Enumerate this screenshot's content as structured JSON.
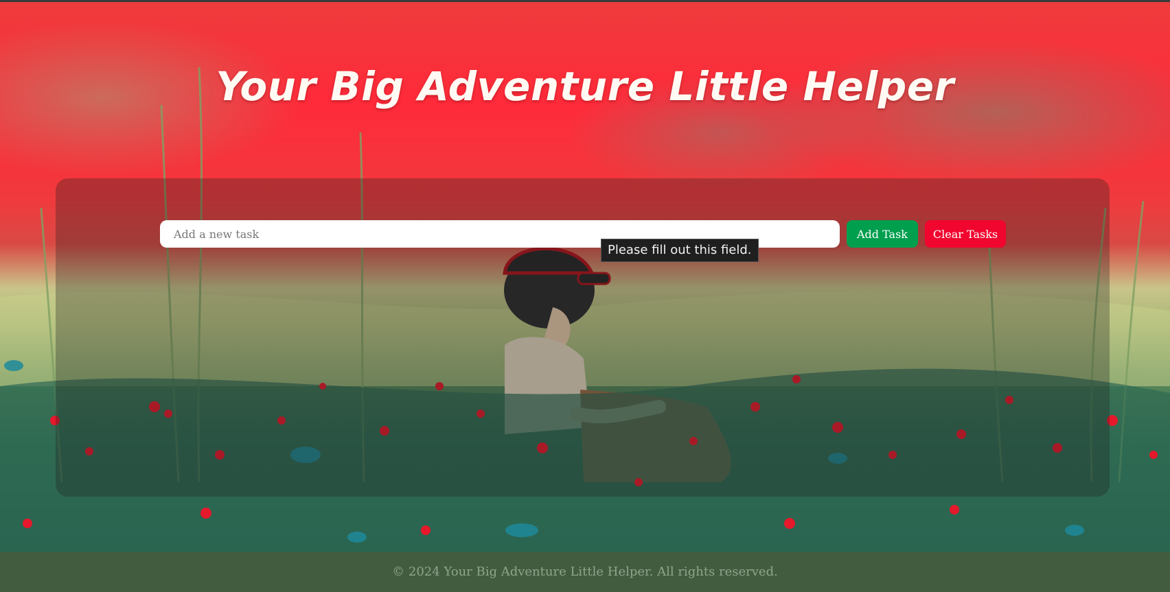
{
  "header": {
    "title": "Your Big Adventure Little Helper"
  },
  "task_form": {
    "input_placeholder": "Add a new task",
    "input_value": "",
    "add_label": "Add Task",
    "clear_label": "Clear Tasks"
  },
  "validation_tooltip": "Please fill out this field.",
  "footer": {
    "text": "© 2024 Your Big Adventure Little Helper. All rights reserved."
  },
  "colors": {
    "add_button": "#009f4e",
    "clear_button": "#f0062e",
    "footer_bg": "#425c40",
    "sky": "#ff2a3a"
  }
}
